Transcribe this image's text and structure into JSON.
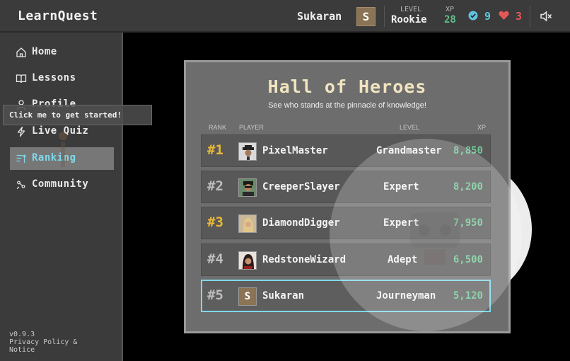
{
  "app": {
    "title": "LearnQuest"
  },
  "user": {
    "name": "Sukaran",
    "avatar_letter": "S"
  },
  "stats": {
    "level_caption": "LEVEL",
    "level": "Rookie",
    "xp_caption": "XP",
    "xp": "28",
    "correct": "9",
    "lives": "3"
  },
  "icons": {
    "sound": "sound-off-icon",
    "check": "check-circle-icon",
    "heart": "heart-icon"
  },
  "colors": {
    "accent": "#7fd8ea",
    "gold": "#e7b93a",
    "xp_green": "#6fc694",
    "heart": "#e45757"
  },
  "sidebar": {
    "items": [
      {
        "label": "Home",
        "icon": "home-icon"
      },
      {
        "label": "Lessons",
        "icon": "book-icon"
      },
      {
        "label": "Profile",
        "icon": "user-icon"
      },
      {
        "label": "Live Quiz",
        "icon": "lightning-icon"
      },
      {
        "label": "Ranking",
        "icon": "ranking-icon",
        "active": true
      },
      {
        "label": "Community",
        "icon": "community-icon"
      }
    ],
    "footer": {
      "version": "v0.9.3",
      "policy_line1": "Privacy Policy &",
      "policy_line2": "Notice"
    }
  },
  "tooltip": {
    "text": "Click me to get started!"
  },
  "leaderboard": {
    "title": "Hall of Heroes",
    "subtitle": "See who stands at the pinnacle of knowledge!",
    "columns": {
      "rank": "RANK",
      "player": "PLAYER",
      "level": "LEVEL",
      "xp": "XP"
    },
    "rows": [
      {
        "rank": "#1",
        "player": "PixelMaster",
        "level": "Grandmaster",
        "xp": "8,850"
      },
      {
        "rank": "#2",
        "player": "CreeperSlayer",
        "level": "Expert",
        "xp": "8,200"
      },
      {
        "rank": "#3",
        "player": "DiamondDigger",
        "level": "Expert",
        "xp": "7,950"
      },
      {
        "rank": "#4",
        "player": "RedstoneWizard",
        "level": "Adept",
        "xp": "6,500"
      },
      {
        "rank": "#5",
        "player": "Sukaran",
        "level": "Journeyman",
        "xp": "5,120",
        "avatar_letter": "S"
      }
    ]
  }
}
